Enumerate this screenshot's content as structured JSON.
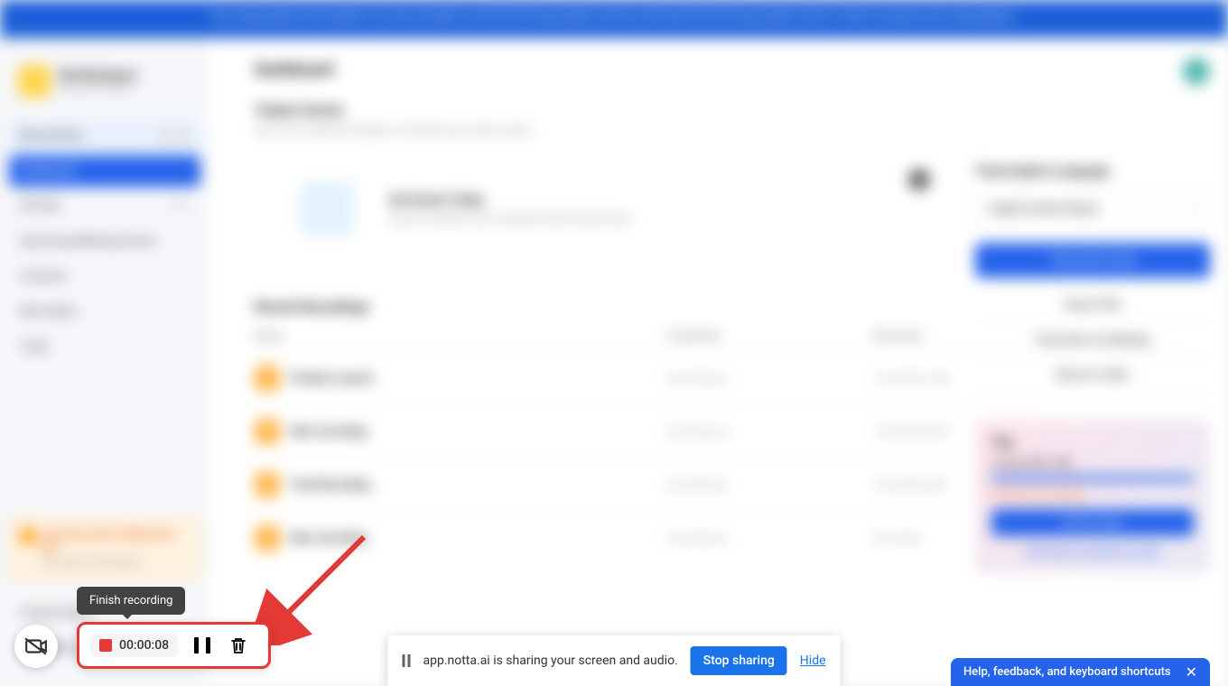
{
  "banner": {
    "text": "Your subscription has expired. You are not able to use the full transcription service until start the full transcription trial of. Click to resume your subscription."
  },
  "workspace": {
    "name": "My Workspace",
    "subtitle": "Personal Version",
    "avatar_initial": "M"
  },
  "sidebar": {
    "record_now": "Record Now",
    "items": [
      "Dashboard",
      "All Files",
      "Upcoming Meeting Events",
      "Contacts",
      "My Folders",
      "Trash"
    ],
    "promo_title": "3-day free trial for Without the ads",
    "promo_sub": "Unlimited Transcription",
    "bottom_items": [
      "Contact Sales",
      "Invite Members"
    ]
  },
  "dashboard": {
    "title": "Dashboard",
    "events_title": "Today's Events",
    "events_sub": "Sync your calendar (Google or Outlook) and create events.",
    "no_events_title": "No Events Today",
    "no_events_sub": "Events created in your calendar will be shown here",
    "recent_title": "Recent Recordings",
    "columns": {
      "name": "Name",
      "created": "Created By",
      "date": "Start Date"
    },
    "rows": [
      {
        "title": "Product Launch",
        "creator": "Paul Hillsman",
        "date": "7-Oct-2023 10:08"
      },
      {
        "title": "New recording",
        "creator": "Paul Hillsman",
        "date": "7-Oct-2023 06:20"
      },
      {
        "title": "Test Recording",
        "creator": "Paul Hillsman",
        "date": "7-Oct-2023 04:01"
      },
      {
        "title": "New recording",
        "creator": "Paul Hillsman",
        "date": "6-Oct-2023"
      }
    ]
  },
  "right_panel": {
    "lang_title": "Transcription Language",
    "lang_value": "English (United States)",
    "transcribe": "Transcribe Audio",
    "import": "Import Files",
    "live": "Transcribe Live Meeting",
    "record": "Record a Video",
    "tips_title": "Tips",
    "tips_line1": "January 600 / 600",
    "tips_line2": "Storage was updated",
    "tips_btn": "Get Pro Plan",
    "tips_link": "Click here to manage your plan"
  },
  "tooltip": "Finish recording",
  "recording": {
    "timer": "00:00:08"
  },
  "sharing": {
    "text": "app.notta.ai is sharing your screen and audio.",
    "stop": "Stop sharing",
    "hide": "Hide"
  },
  "help": {
    "label": "Help, feedback, and keyboard shortcuts"
  }
}
